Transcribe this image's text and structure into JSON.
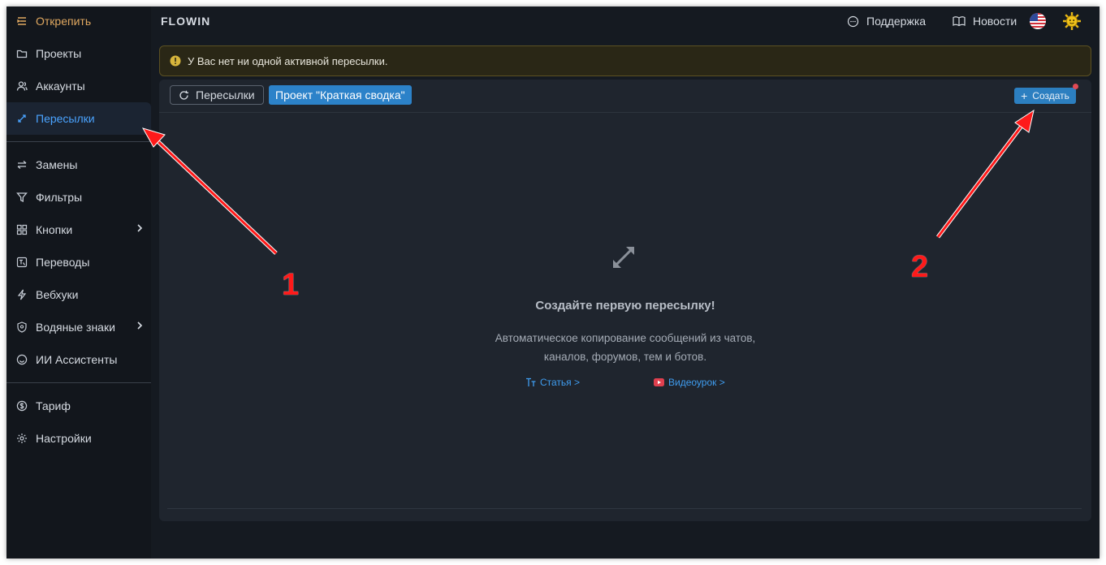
{
  "sidebar": {
    "unpin_label": "Открепить",
    "items": [
      {
        "label": "Проекты"
      },
      {
        "label": "Аккаунты"
      },
      {
        "label": "Пересылки"
      },
      {
        "label": "Замены"
      },
      {
        "label": "Фильтры"
      },
      {
        "label": "Кнопки"
      },
      {
        "label": "Переводы"
      },
      {
        "label": "Вебхуки"
      },
      {
        "label": "Водяные знаки"
      },
      {
        "label": "ИИ Ассистенты"
      },
      {
        "label": "Тариф"
      },
      {
        "label": "Настройки"
      }
    ],
    "active_index": 2
  },
  "header": {
    "brand": "FLOWIN",
    "support_label": "Поддержка",
    "news_label": "Новости"
  },
  "alert": {
    "text": "У Вас нет ни одной активной пересылки."
  },
  "toolbar": {
    "reload_label": "Пересылки",
    "project_label": "Проект \"Краткая сводка\"",
    "create_label": "Создать"
  },
  "empty_state": {
    "title": "Создайте первую пересылку!",
    "desc_line1": "Автоматическое копирование сообщений из чатов,",
    "desc_line2": "каналов, форумов, тем и ботов.",
    "article_link": "Статья >",
    "video_link": "Видеоурок >"
  },
  "annotations": {
    "one": "1",
    "two": "2"
  },
  "colors": {
    "accent": "#2c82c9",
    "active_text": "#4aa3ff",
    "unpin": "#e0a860",
    "annotation": "#ff1a1a"
  }
}
